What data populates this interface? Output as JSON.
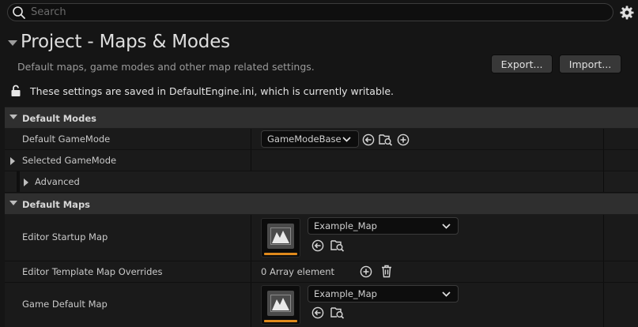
{
  "search": {
    "placeholder": "Search",
    "value": ""
  },
  "header": {
    "title": "Project - Maps & Modes",
    "subtitle": "Default maps, game modes and other map related settings.",
    "export_label": "Export...",
    "import_label": "Import...",
    "notice": "These settings are saved in DefaultEngine.ini, which is currently writable."
  },
  "sections": {
    "default_modes": {
      "label": "Default Modes",
      "default_gamemode": {
        "label": "Default GameMode",
        "value": "GameModeBase"
      },
      "selected_gamemode": {
        "label": "Selected GameMode"
      },
      "advanced": {
        "label": "Advanced"
      }
    },
    "default_maps": {
      "label": "Default Maps",
      "editor_startup_map": {
        "label": "Editor Startup Map",
        "value": "Example_Map"
      },
      "editor_template_overrides": {
        "label": "Editor Template Map Overrides",
        "value": "0 Array element"
      },
      "game_default_map": {
        "label": "Game Default Map",
        "value": "Example_Map"
      }
    }
  },
  "colors": {
    "background": "#151515",
    "category_row": "#2f2f2f",
    "property_row": "#1a1a1a",
    "thumbnail_accent": "#e08a1c"
  },
  "icons": {
    "search": "search-icon",
    "settings": "gear-icon",
    "lock": "unlocked-icon",
    "use_selected": "use-selected-arrow-icon",
    "browse": "browse-folder-icon",
    "add": "add-circle-icon",
    "delete": "trash-icon",
    "map_thumbnail": "level-map-icon"
  }
}
